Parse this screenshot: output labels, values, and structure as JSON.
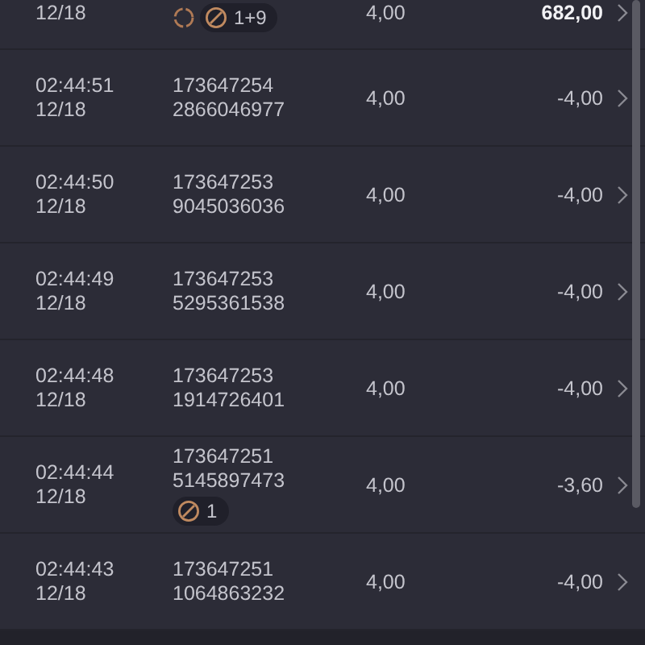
{
  "rows": [
    {
      "date": "12/18",
      "qty": "4,00",
      "amount": "682,00",
      "emphasis": true,
      "tags": [
        {
          "kind": "loading"
        },
        {
          "kind": "pill",
          "text": "1+9"
        }
      ]
    },
    {
      "time": "02:44:51",
      "date": "12/18",
      "id": "173647254",
      "ref": "2866046977",
      "qty": "4,00",
      "amount": "-4,00",
      "emphasis": false,
      "tags": []
    },
    {
      "time": "02:44:50",
      "date": "12/18",
      "id": "173647253",
      "ref": "9045036036",
      "qty": "4,00",
      "amount": "-4,00",
      "emphasis": false,
      "tags": []
    },
    {
      "time": "02:44:49",
      "date": "12/18",
      "id": "173647253",
      "ref": "5295361538",
      "qty": "4,00",
      "amount": "-4,00",
      "emphasis": false,
      "tags": []
    },
    {
      "time": "02:44:48",
      "date": "12/18",
      "id": "173647253",
      "ref": "1914726401",
      "qty": "4,00",
      "amount": "-4,00",
      "emphasis": false,
      "tags": []
    },
    {
      "time": "02:44:44",
      "date": "12/18",
      "id": "173647251",
      "ref": "5145897473",
      "qty": "4,00",
      "amount": "-3,60",
      "emphasis": false,
      "tags": [
        {
          "kind": "pill",
          "text": "1"
        }
      ]
    },
    {
      "time": "02:44:43",
      "date": "12/18",
      "id": "173647251",
      "ref": "1064863232",
      "qty": "4,00",
      "amount": "-4,00",
      "emphasis": false,
      "tags": []
    }
  ]
}
